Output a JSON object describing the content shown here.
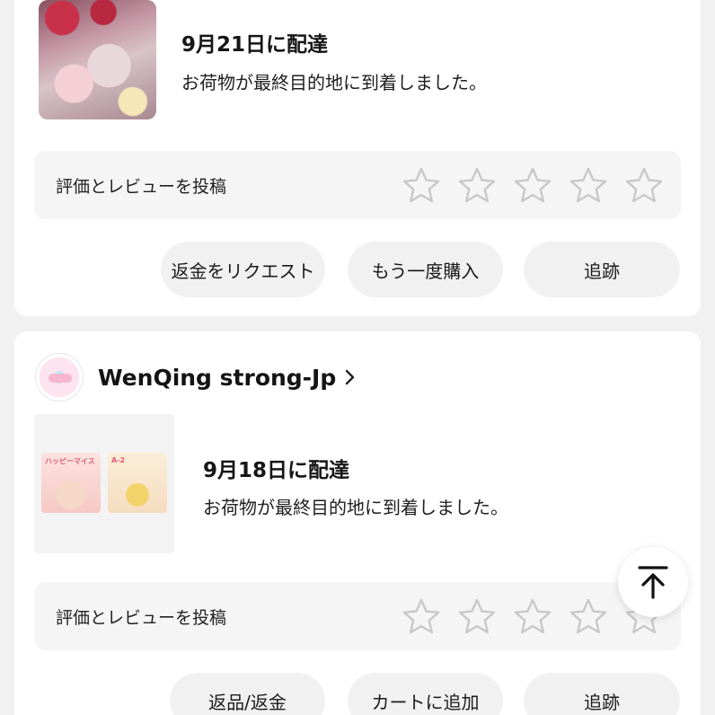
{
  "order1": {
    "delivery_title": "9月21日に配達",
    "delivery_status": "お荷物が最終目的地に到着しました。",
    "review_label": "評価とレビューを投稿",
    "stars": 5,
    "buttons": {
      "refund_request": "返金をリクエスト",
      "buy_again": "もう一度購入",
      "track": "追跡"
    }
  },
  "order2": {
    "shop_name": "WenQing strong-Jp",
    "thumbnails": [
      {
        "label": "ハッピーマイス"
      },
      {
        "label": "A-2"
      }
    ],
    "delivery_title": "9月18日に配達",
    "delivery_status": "お荷物が最終目的地に到着しました。",
    "review_label": "評価とレビューを投稿",
    "stars": 5,
    "buttons": {
      "return_refund": "返品/返金",
      "add_to_cart": "カートに追加",
      "track": "追跡"
    }
  },
  "icons": {
    "star": "star-outline-icon",
    "chevron": "chevron-right-icon",
    "scroll_top": "arrow-up-to-top-icon"
  },
  "colors": {
    "background": "#f1f1f1",
    "card": "#ffffff",
    "pill": "#f1f1f1",
    "star_stroke": "#c8c8c8"
  }
}
